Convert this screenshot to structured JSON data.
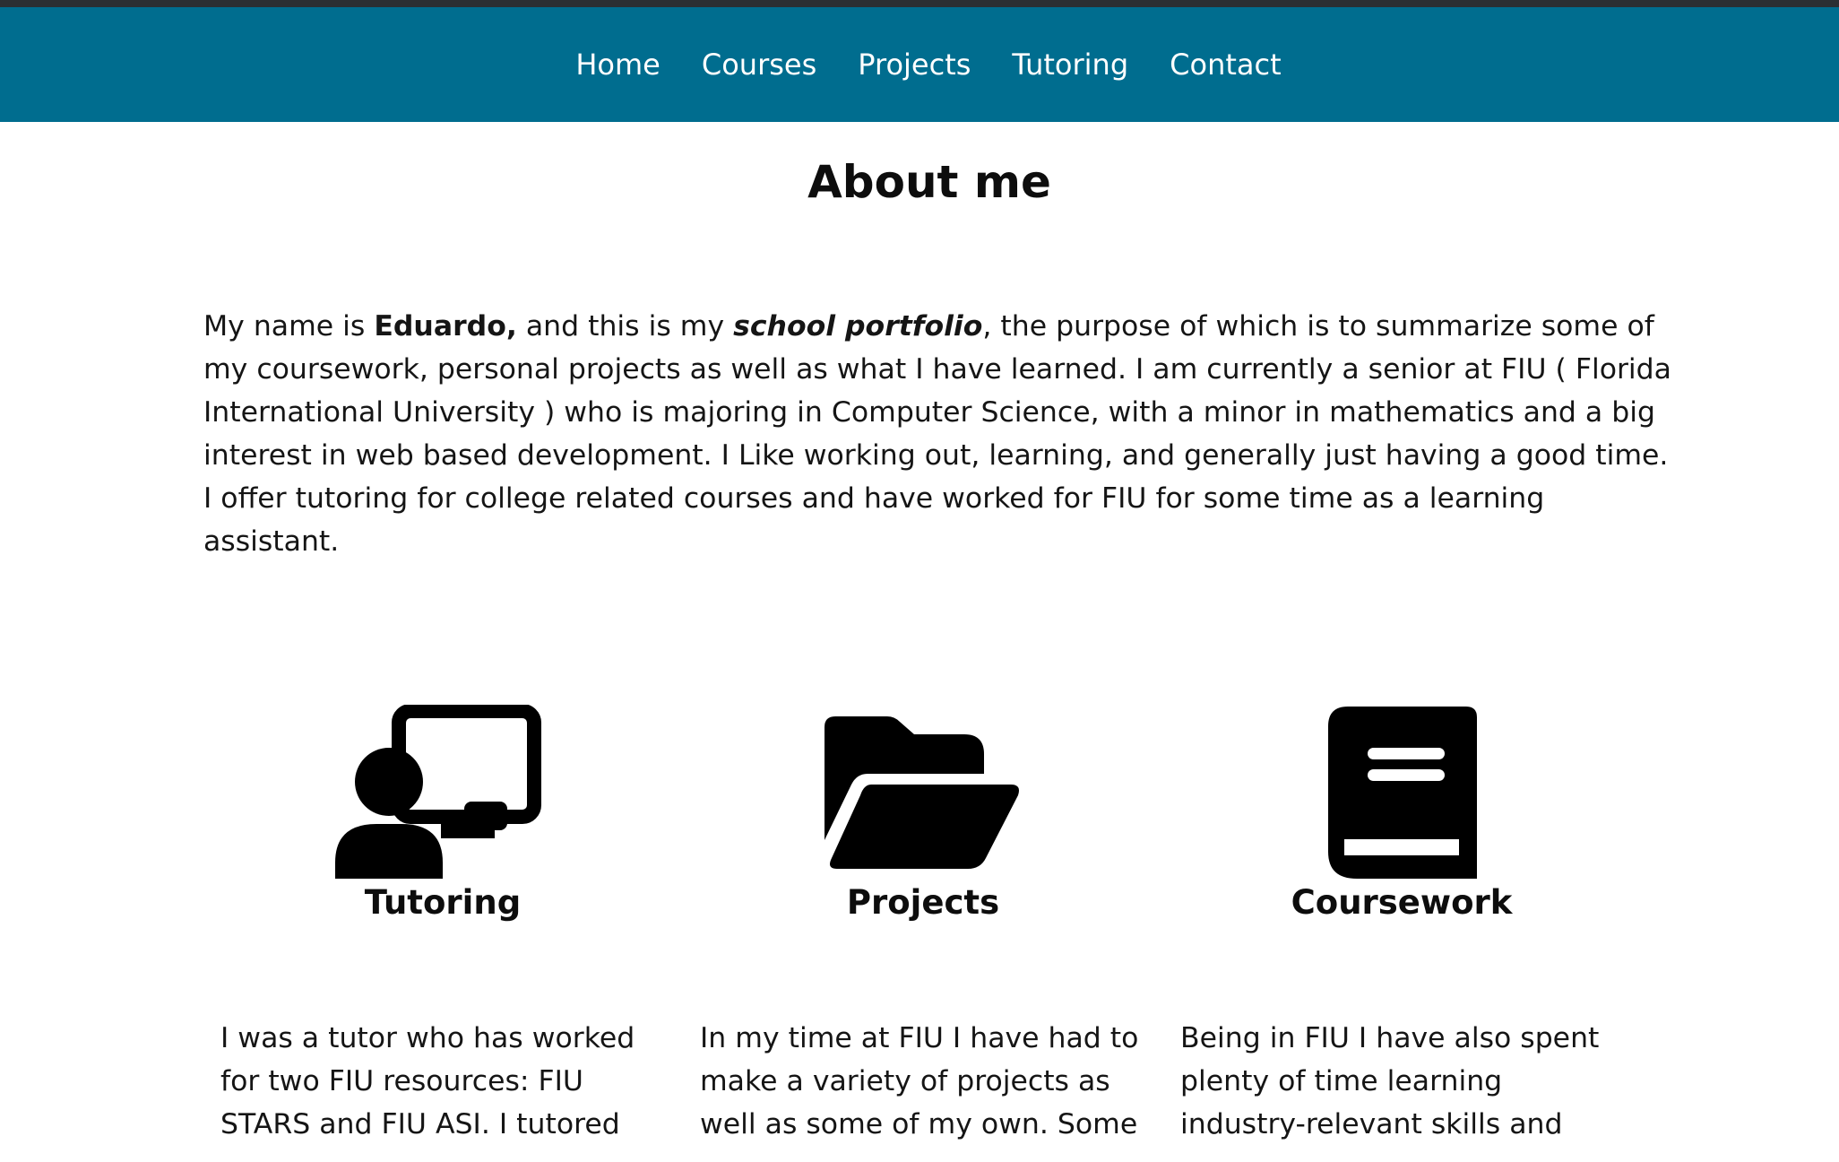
{
  "nav": {
    "items": [
      {
        "label": "Home"
      },
      {
        "label": "Courses"
      },
      {
        "label": "Projects"
      },
      {
        "label": "Tutoring"
      },
      {
        "label": "Contact"
      }
    ]
  },
  "about": {
    "title": "About me",
    "intro_prefix": "My name is ",
    "intro_name": "Eduardo,",
    "intro_mid": " and this is my ",
    "intro_emphasis": "school portfolio",
    "intro_rest": ", the purpose of which is to summarize some of my coursework, personal projects as well as what I have learned. I am currently a senior at FIU ( Florida International University ) who is majoring in Computer Science, with a minor in mathematics and a big interest in web based development. I Like working out, learning, and generally just having a good time. I offer tutoring for college related courses and have worked for FIU for some time as a learning assistant."
  },
  "cards": [
    {
      "icon": "teacher-board-icon",
      "title": "Tutoring",
      "text": "I was a tutor who has worked for two FIU resources: FIU STARS and FIU ASI. I tutored"
    },
    {
      "icon": "folder-open-icon",
      "title": "Projects",
      "text": "In my time at FIU I have had to make a variety of projects as well as some of my own. Some"
    },
    {
      "icon": "book-icon",
      "title": "Coursework",
      "text": "Being in FIU I have also spent plenty of time learning industry-relevant skills and"
    }
  ],
  "colors": {
    "nav_background": "#006d8f",
    "nav_text": "#ffffff",
    "top_strip": "#2b2f33",
    "text": "#111111"
  }
}
